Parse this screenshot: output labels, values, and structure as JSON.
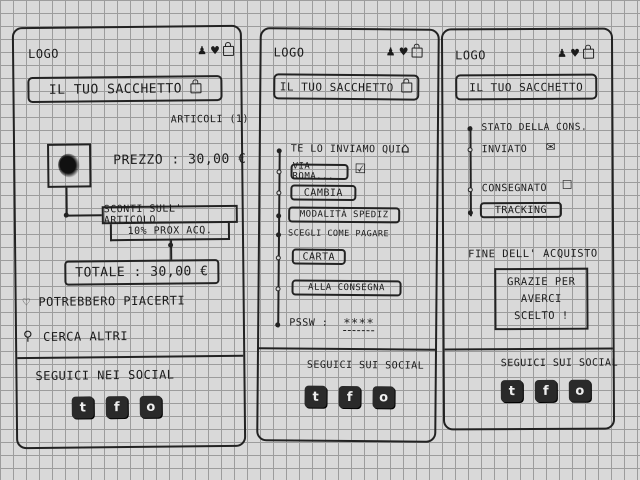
{
  "screen1": {
    "logo": "LOGO",
    "bag_title": "IL TUO SACCHETTO",
    "items_count": "ARTICOLI (1)",
    "price": "PREZZO : 30,00 €",
    "discount_line1": "SCONTI SULL' ARTICOLO",
    "discount_line2": "10% PROX ACQ.",
    "total": "TOTALE : 30,00 €",
    "wishlist": "POTREBBERO PIACERTI",
    "search": "CERCA ALTRI",
    "social_title": "SEGUICI NEI SOCIAL",
    "social": [
      "t",
      "f",
      "o"
    ]
  },
  "screen2": {
    "logo": "LOGO",
    "bag_title": "IL TUO SACCHETTO",
    "ship_here": "TE LO INVIAMO QUI",
    "address": "VIA ROMA...",
    "change": "CAMBIA",
    "shipping_mode": "MODALITÀ SPEDIZ",
    "choose_pay": "SCEGLI COME PAGARE",
    "card": "CARTA",
    "to_delivery": "ALLA CONSEGNA",
    "password_label": "PSSW :",
    "password_value": "****",
    "social_title": "SEGUICI SUI SOCIAL",
    "social": [
      "t",
      "f",
      "o"
    ]
  },
  "screen3": {
    "logo": "LOGO",
    "bag_title": "IL TUO SACCHETTO",
    "status_title": "STATO DELLA CONS.",
    "sent": "INVIATO",
    "delivered": "CONSEGNATO",
    "tracking": "TRACKING",
    "end_title": "FINE DELL' ACQUISTO",
    "thanks_line1": "GRAZIE PER",
    "thanks_line2": "AVERCI",
    "thanks_line3": "SCELTO !",
    "social_title": "SEGUICI SUI SOCIAL",
    "social": [
      "t",
      "f",
      "o"
    ]
  }
}
